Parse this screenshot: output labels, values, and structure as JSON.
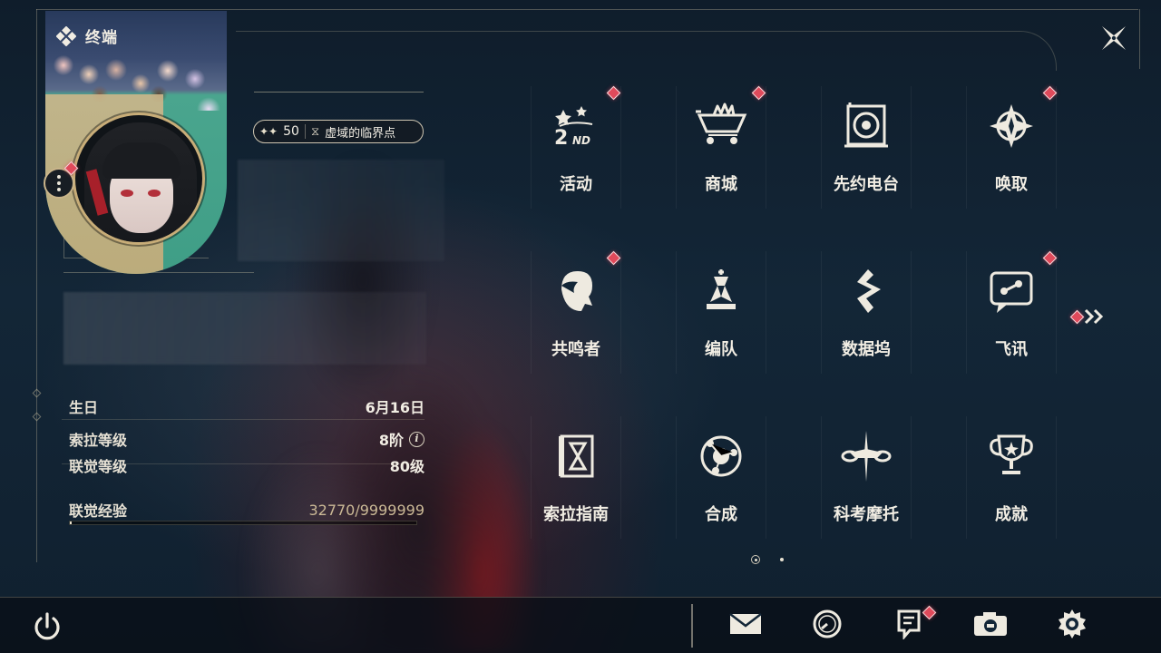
{
  "header": {
    "title": "终端"
  },
  "profile": {
    "level": "50",
    "title": "虚域的临界点"
  },
  "stats": {
    "birthday_label": "生日",
    "birthday_value": "6月16日",
    "sola_label": "索拉等级",
    "sola_value": "8阶",
    "union_label": "联觉等级",
    "union_value": "80级",
    "exp_label": "联觉经验",
    "exp_value": "32770/9999999",
    "exp_fraction": 0.0033
  },
  "grid": {
    "tiles": [
      {
        "label": "活动",
        "icon": "event-2nd-anniversary-icon",
        "badge": true
      },
      {
        "label": "商城",
        "icon": "shop-cart-crown-icon",
        "badge": true
      },
      {
        "label": "先约电台",
        "icon": "radio-record-icon",
        "badge": false
      },
      {
        "label": "唤取",
        "icon": "convene-compass-icon",
        "badge": true
      },
      {
        "label": "共鸣者",
        "icon": "resonator-portrait-icon",
        "badge": true
      },
      {
        "label": "编队",
        "icon": "team-chess-icon",
        "badge": false
      },
      {
        "label": "数据坞",
        "icon": "data-bank-icon",
        "badge": false
      },
      {
        "label": "飞讯",
        "icon": "message-chat-icon",
        "badge": true
      },
      {
        "label": "索拉指南",
        "icon": "guide-book-icon",
        "badge": false
      },
      {
        "label": "合成",
        "icon": "synthesis-orbit-icon",
        "badge": false
      },
      {
        "label": "科考摩托",
        "icon": "motorcycle-icon",
        "badge": false
      },
      {
        "label": "成就",
        "icon": "achievement-trophy-icon",
        "badge": false
      }
    ]
  },
  "pager": {
    "current_page": 1,
    "total_pages": 2
  },
  "bottom_bar": {
    "buttons": [
      "mail-icon",
      "clock-icon",
      "notice-icon",
      "camera-icon",
      "settings-gear-icon"
    ],
    "notice_badge": true
  },
  "colors": {
    "accent_badge": "#e04a5b",
    "frame_gold": "#c8ad78",
    "text_primary": "#f2eee4",
    "background": "#132637"
  }
}
